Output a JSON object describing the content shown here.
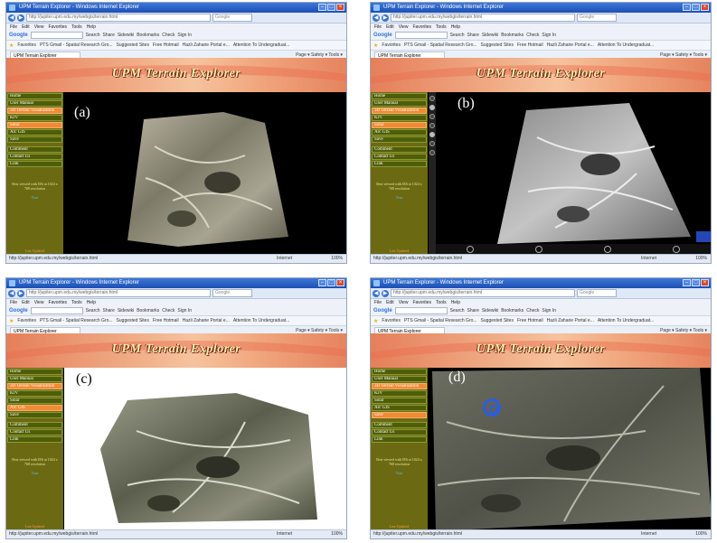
{
  "browser": {
    "title": "UPM Terrain Explorer - Windows Internet Explorer",
    "url": "http://jupiter.upm.edu.my/webgis/terrain.html",
    "search_placeholder": "Google",
    "menu": [
      "File",
      "Edit",
      "View",
      "Favorites",
      "Tools",
      "Help"
    ],
    "google_label": "Google",
    "google_items": [
      "Search",
      "Share",
      "Sidewiki",
      "Bookmarks",
      "Check",
      "Sign In"
    ],
    "favorites_label": "Favorites",
    "favorites_links": [
      "PTS Gmail - Spatial Research Gro...",
      "Suggested Sites",
      "Free Hotmail",
      "Hazli Zaharie Portal e...",
      "Attention To Undergraduat..."
    ],
    "tab_label": "UPM Terrain Explorer",
    "tools_text": "Page ▾  Safety ▾  Tools ▾",
    "status_url": "http://jupiter.upm.edu.my/webgis/terrain.html",
    "status_zone": "Internet",
    "zoom": "100%"
  },
  "site": {
    "title": "UPM Terrain Explorer",
    "menu": [
      "Home",
      "User Manual",
      "3D Terrain Visualization",
      "KJV",
      "Solar",
      "Arc GIS",
      "Save",
      "Comment",
      "Contact Us",
      "Link"
    ],
    "note": "Best viewed with IE6 at 1024 x 768 resolution",
    "note_link": "Tour",
    "footer": "Last Updated"
  },
  "panels": [
    {
      "label": "(a)",
      "active": [
        2,
        4
      ]
    },
    {
      "label": "(b)",
      "active": [
        2,
        4
      ]
    },
    {
      "label": "(c)",
      "active": [
        2,
        5
      ]
    },
    {
      "label": "(d)",
      "active": [
        2,
        6
      ]
    }
  ],
  "colors": {
    "sidebar": "#6b6a13",
    "menu_item": "#4e5d0a",
    "menu_active": "#f08a34",
    "banner_title": "#f7f2b0",
    "titlebar": "#1d4fb3"
  }
}
